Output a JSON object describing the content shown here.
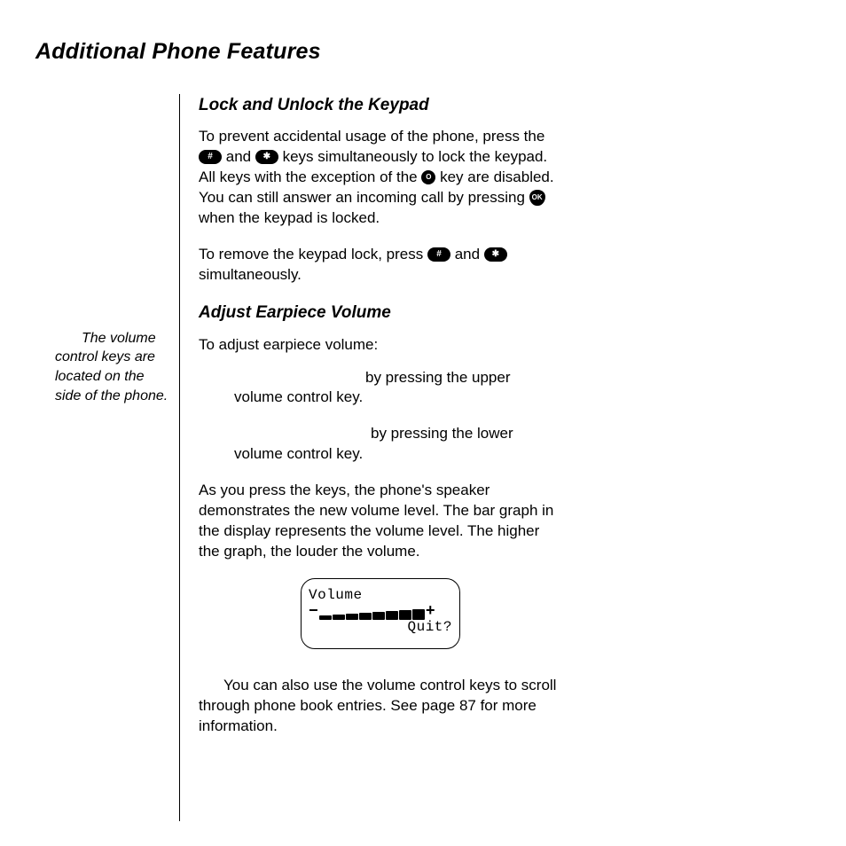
{
  "page_title": "Additional Phone Features",
  "margin_note": "The volume control keys are located on the side of the phone.",
  "sections": {
    "lock": {
      "title": "Lock and Unlock the Keypad",
      "p1_lead": "To prevent accidental usage of the phone, press the ",
      "p1_join1": " and ",
      "p1_after_keys": " keys simultaneously to lock the keypad. All keys with the exception of the ",
      "p1_after_o": " key are disabled. You can still answer an incoming call by pressing ",
      "p1_tail": " when the keypad is locked.",
      "p2_lead": "To remove the keypad lock, press ",
      "p2_join": " and ",
      "p2_tail": " simultaneously."
    },
    "volume": {
      "title": "Adjust Earpiece Volume",
      "intro": "To adjust earpiece volume:",
      "bullet1": "by pressing the upper volume control key.",
      "bullet2": "by pressing the lower volume control key.",
      "explain": "As you press the keys, the phone's speaker demonstrates the new volume level. The bar graph in the display represents the volume level. The higher the graph, the louder the volume.",
      "tip": "You can also use the volume control keys to scroll through phone book entries. See page 87 for more information."
    }
  },
  "icons": {
    "hash": "#",
    "star": "✱",
    "power": "O",
    "ok": "OK"
  },
  "lcd": {
    "title": "Volume",
    "quit": "Quit?",
    "minus": "−",
    "plus": "+"
  }
}
